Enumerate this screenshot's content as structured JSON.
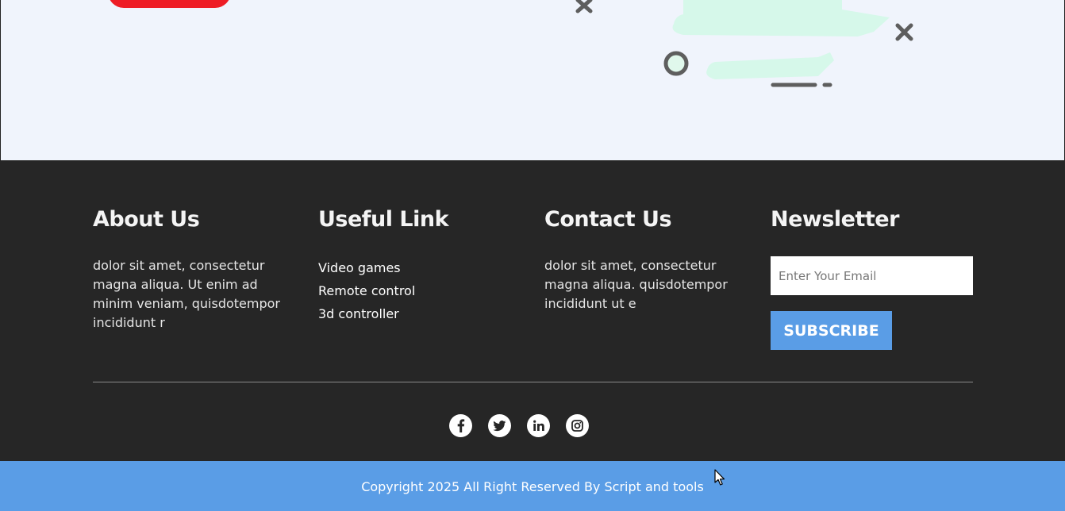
{
  "footer": {
    "about": {
      "heading": "About Us",
      "text": "dolor sit amet, consectetur magna aliqua. Ut enim ad minim veniam, quisdotempor incididunt r"
    },
    "useful": {
      "heading": "Useful Link",
      "links": [
        "Video games",
        "Remote control",
        "3d controller"
      ]
    },
    "contact": {
      "heading": "Contact Us",
      "text": "dolor sit amet, consectetur magna aliqua. quisdotempor incididunt ut e"
    },
    "newsletter": {
      "heading": "Newsletter",
      "email_placeholder": "Enter Your Email",
      "email_value": "",
      "subscribe_label": "SUBSCRIBE"
    },
    "social_icons": [
      "facebook-icon",
      "twitter-icon",
      "linkedin-icon",
      "instagram-icon"
    ]
  },
  "copyright": {
    "text": "Copyright 2025 All Right Reserved By Script and tools"
  },
  "colors": {
    "hero_bg": "#f0f4fc",
    "hero_button": "#ee1c25",
    "footer_bg": "#262626",
    "accent": "#5a9de6"
  }
}
